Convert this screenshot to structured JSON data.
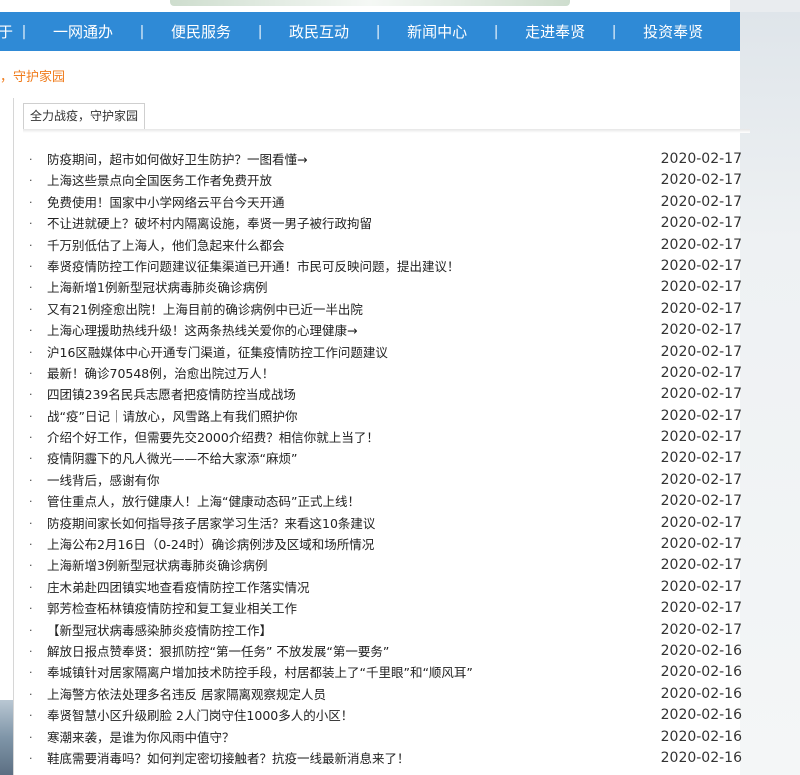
{
  "nav": {
    "items": [
      {
        "label": "于"
      },
      {
        "label": "一网通办"
      },
      {
        "label": "便民服务"
      },
      {
        "label": "政民互动"
      },
      {
        "label": "新闻中心"
      },
      {
        "label": "走进奉贤"
      },
      {
        "label": "投资奉贤"
      }
    ],
    "separator": "|"
  },
  "breadcrumb": {
    "text": "，守护家园"
  },
  "tab": {
    "label": "全力战疫，守护家园"
  },
  "bullet": "·",
  "news": [
    {
      "title": "防疫期间，超市如何做好卫生防护？一图看懂→",
      "date": "2020-02-17"
    },
    {
      "title": "上海这些景点向全国医务工作者免费开放",
      "date": "2020-02-17"
    },
    {
      "title": "免费使用！国家中小学网络云平台今天开通",
      "date": "2020-02-17"
    },
    {
      "title": "不让进就硬上？破坏村内隔离设施，奉贤一男子被行政拘留",
      "date": "2020-02-17"
    },
    {
      "title": "千万别低估了上海人，他们急起来什么都会",
      "date": "2020-02-17"
    },
    {
      "title": "奉贤疫情防控工作问题建议征集渠道已开通！市民可反映问题，提出建议！",
      "date": "2020-02-17"
    },
    {
      "title": "上海新增1例新型冠状病毒肺炎确诊病例",
      "date": "2020-02-17"
    },
    {
      "title": "又有21例痊愈出院！上海目前的确诊病例中已近一半出院",
      "date": "2020-02-17"
    },
    {
      "title": "上海心理援助热线升级！这两条热线关爱你的心理健康→",
      "date": "2020-02-17"
    },
    {
      "title": "沪16区融媒体中心开通专门渠道，征集疫情防控工作问题建议",
      "date": "2020-02-17"
    },
    {
      "title": "最新！确诊70548例，治愈出院过万人！",
      "date": "2020-02-17"
    },
    {
      "title": "四团镇239名民兵志愿者把疫情防控当成战场",
      "date": "2020-02-17"
    },
    {
      "title": "战“疫”日记｜请放心，风雪路上有我们照护你",
      "date": "2020-02-17"
    },
    {
      "title": "介绍个好工作，但需要先交2000介绍费？相信你就上当了！",
      "date": "2020-02-17"
    },
    {
      "title": "疫情阴霾下的凡人微光——不给大家添“麻烦”",
      "date": "2020-02-17"
    },
    {
      "title": "一线背后，感谢有你",
      "date": "2020-02-17"
    },
    {
      "title": "管住重点人，放行健康人！上海“健康动态码”正式上线！",
      "date": "2020-02-17"
    },
    {
      "title": "防疫期间家长如何指导孩子居家学习生活？来看这10条建议",
      "date": "2020-02-17"
    },
    {
      "title": "上海公布2月16日（0-24时）确诊病例涉及区域和场所情况",
      "date": "2020-02-17"
    },
    {
      "title": "上海新增3例新型冠状病毒肺炎确诊病例",
      "date": "2020-02-17"
    },
    {
      "title": "庄木弟赴四团镇实地查看疫情防控工作落实情况",
      "date": "2020-02-17"
    },
    {
      "title": "郭芳检查柘林镇疫情防控和复工复业相关工作",
      "date": "2020-02-17"
    },
    {
      "title": "【新型冠状病毒感染肺炎疫情防控工作】",
      "date": "2020-02-17"
    },
    {
      "title": "解放日报点赞奉贤：狠抓防控“第一任务” 不放发展“第一要务”",
      "date": "2020-02-16"
    },
    {
      "title": "奉城镇针对居家隔离户增加技术防控手段，村居都装上了“千里眼”和“顺风耳”",
      "date": "2020-02-16"
    },
    {
      "title": "上海警方依法处理多名违反 居家隔离观察规定人员",
      "date": "2020-02-16"
    },
    {
      "title": "奉贤智慧小区升级刷脸 2人门岗守住1000多人的小区！",
      "date": "2020-02-16"
    },
    {
      "title": "寒潮来袭，是谁为你风雨中值守？",
      "date": "2020-02-16"
    },
    {
      "title": "鞋底需要消毒吗？如何判定密切接触者？抗疫一线最新消息来了！",
      "date": "2020-02-16"
    }
  ]
}
